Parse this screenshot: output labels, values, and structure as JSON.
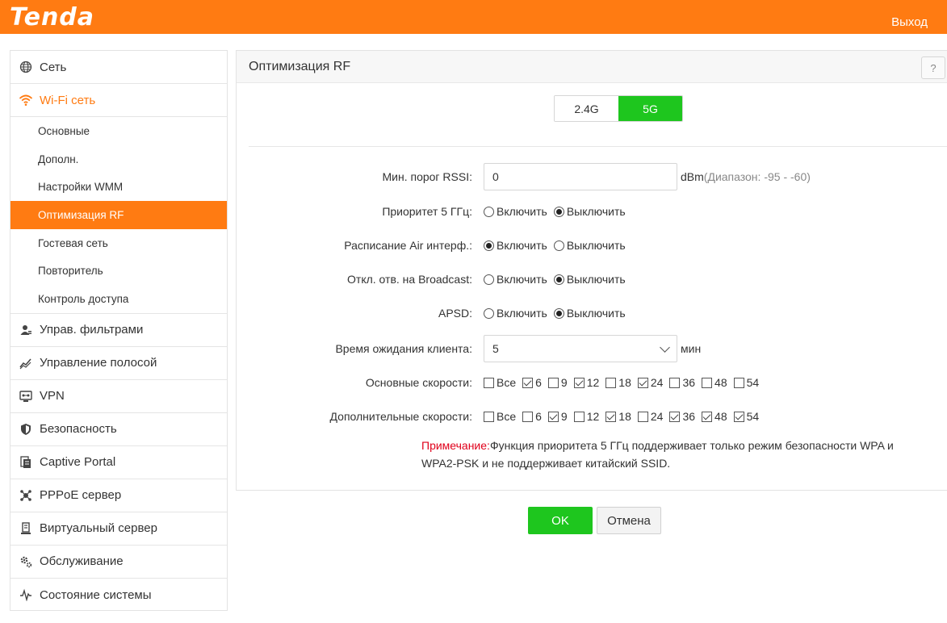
{
  "header": {
    "logo": "Tenda",
    "logout": "Выход"
  },
  "sidebar": {
    "items": [
      {
        "label": "Сеть",
        "icon": "globe-icon"
      },
      {
        "label": "Wi-Fi сеть",
        "icon": "wifi-icon"
      },
      {
        "label": "Управ. фильтрами",
        "icon": "user-filter-icon"
      },
      {
        "label": "Управление полосой",
        "icon": "bandwidth-icon"
      },
      {
        "label": "VPN",
        "icon": "vpn-icon"
      },
      {
        "label": "Безопасность",
        "icon": "shield-icon"
      },
      {
        "label": "Captive Portal",
        "icon": "captive-portal-icon"
      },
      {
        "label": "PPPoE сервер",
        "icon": "pppoe-icon"
      },
      {
        "label": "Виртуальный сервер",
        "icon": "server-icon"
      },
      {
        "label": "Обслуживание",
        "icon": "gear-icon"
      },
      {
        "label": "Состояние системы",
        "icon": "pulse-icon"
      }
    ],
    "wifi_sub": [
      {
        "label": "Основные"
      },
      {
        "label": "Дополн."
      },
      {
        "label": "Настройки WMM"
      },
      {
        "label": "Оптимизация RF"
      },
      {
        "label": "Гостевая сеть"
      },
      {
        "label": "Повторитель"
      },
      {
        "label": "Контроль доступа"
      }
    ],
    "accent": "#ff7b12"
  },
  "panel": {
    "title": "Оптимизация RF",
    "help": "?",
    "bands": [
      "2.4G",
      "5G"
    ],
    "active_band": "5G",
    "rssi": {
      "label": "Мин. порог RSSI:",
      "value": "0",
      "unit": "dBm",
      "range": "(Диапазон: -95 - -60)"
    },
    "radio_on": "Включить",
    "radio_off": "Выключить",
    "prio5": {
      "label": "Приоритет 5 ГГц:",
      "selected": "off"
    },
    "airtime": {
      "label": "Расписание Air интерф.:",
      "selected": "on"
    },
    "broadcast": {
      "label": "Откл. отв. на Broadcast:",
      "selected": "off"
    },
    "apsd": {
      "label": "APSD:",
      "selected": "off"
    },
    "timeout": {
      "label": "Время ожидания клиента:",
      "value": "5",
      "unit": "мин"
    },
    "basic_rates": {
      "label": "Основные скорости:",
      "options": [
        {
          "label": "Все",
          "checked": false
        },
        {
          "label": "6",
          "checked": true
        },
        {
          "label": "9",
          "checked": false
        },
        {
          "label": "12",
          "checked": true
        },
        {
          "label": "18",
          "checked": false
        },
        {
          "label": "24",
          "checked": true
        },
        {
          "label": "36",
          "checked": false
        },
        {
          "label": "48",
          "checked": false
        },
        {
          "label": "54",
          "checked": false
        }
      ]
    },
    "extra_rates": {
      "label": "Дополнительные скорости:",
      "options": [
        {
          "label": "Все",
          "checked": false
        },
        {
          "label": "6",
          "checked": false
        },
        {
          "label": "9",
          "checked": true
        },
        {
          "label": "12",
          "checked": false
        },
        {
          "label": "18",
          "checked": true
        },
        {
          "label": "24",
          "checked": false
        },
        {
          "label": "36",
          "checked": true
        },
        {
          "label": "48",
          "checked": true
        },
        {
          "label": "54",
          "checked": true
        }
      ]
    },
    "note_prefix": "Примечание:",
    "note_line1": "Функция приоритета 5 ГГц поддерживает только режим безопасности WPA и",
    "note_line2": "WPA2-PSK и не поддерживает китайский SSID."
  },
  "buttons": {
    "ok": "OK",
    "cancel": "Отмена",
    "ok_color": "#1ec61e"
  }
}
